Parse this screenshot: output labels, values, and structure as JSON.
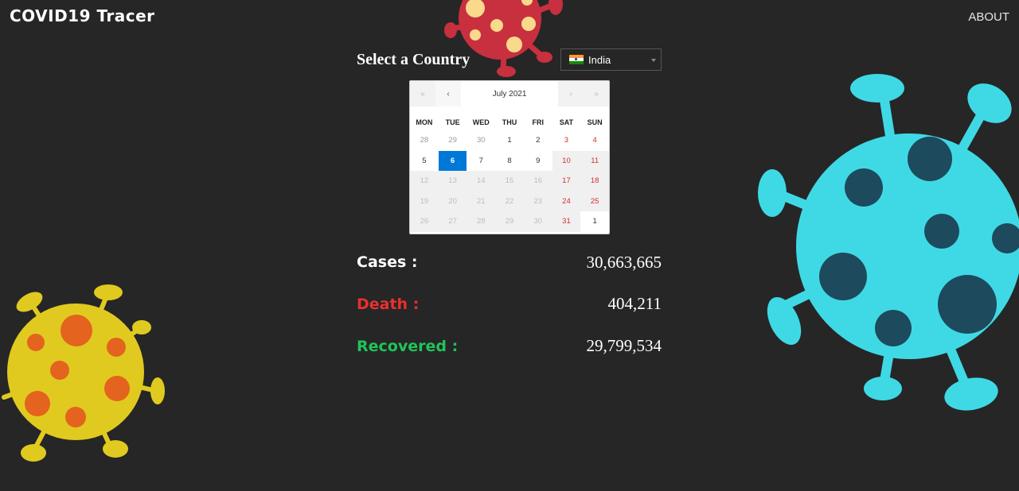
{
  "header": {
    "brand": "COVID19 Tracer",
    "about": "ABOUT"
  },
  "selector": {
    "label": "Select a Country",
    "country": "India"
  },
  "calendar": {
    "month": "July 2021",
    "nav": {
      "prev_year": "«",
      "prev_month": "‹",
      "next_month": "›",
      "next_year": "»"
    },
    "weekdays": [
      "MON",
      "TUE",
      "WED",
      "THU",
      "FRI",
      "SAT",
      "SUN"
    ],
    "weeks": [
      [
        "28",
        "29",
        "30",
        "1",
        "2",
        "3",
        "4"
      ],
      [
        "5",
        "6",
        "7",
        "8",
        "9",
        "10",
        "11"
      ],
      [
        "12",
        "13",
        "14",
        "15",
        "16",
        "17",
        "18"
      ],
      [
        "19",
        "20",
        "21",
        "22",
        "23",
        "24",
        "25"
      ],
      [
        "26",
        "27",
        "28",
        "29",
        "30",
        "31",
        "1"
      ]
    ],
    "selected": "6"
  },
  "stats": {
    "cases": {
      "label": "Cases :",
      "value": "30,663,665"
    },
    "death": {
      "label": "Death :",
      "value": "404,211"
    },
    "recovered": {
      "label": "Recovered :",
      "value": "29,799,534"
    }
  },
  "colors": {
    "background": "#262626",
    "death": "#e8302f",
    "recovered": "#1fc45a",
    "selected_day": "#0078d7",
    "virus_cyan": "#3fd9e6",
    "virus_yellow": "#e0ca1f",
    "virus_red": "#c8303f"
  },
  "icons": {
    "flag": "india-flag-icon",
    "dropdown": "chevron-down-icon",
    "decor": [
      "virus-icon-red",
      "virus-icon-cyan",
      "virus-icon-yellow"
    ]
  }
}
